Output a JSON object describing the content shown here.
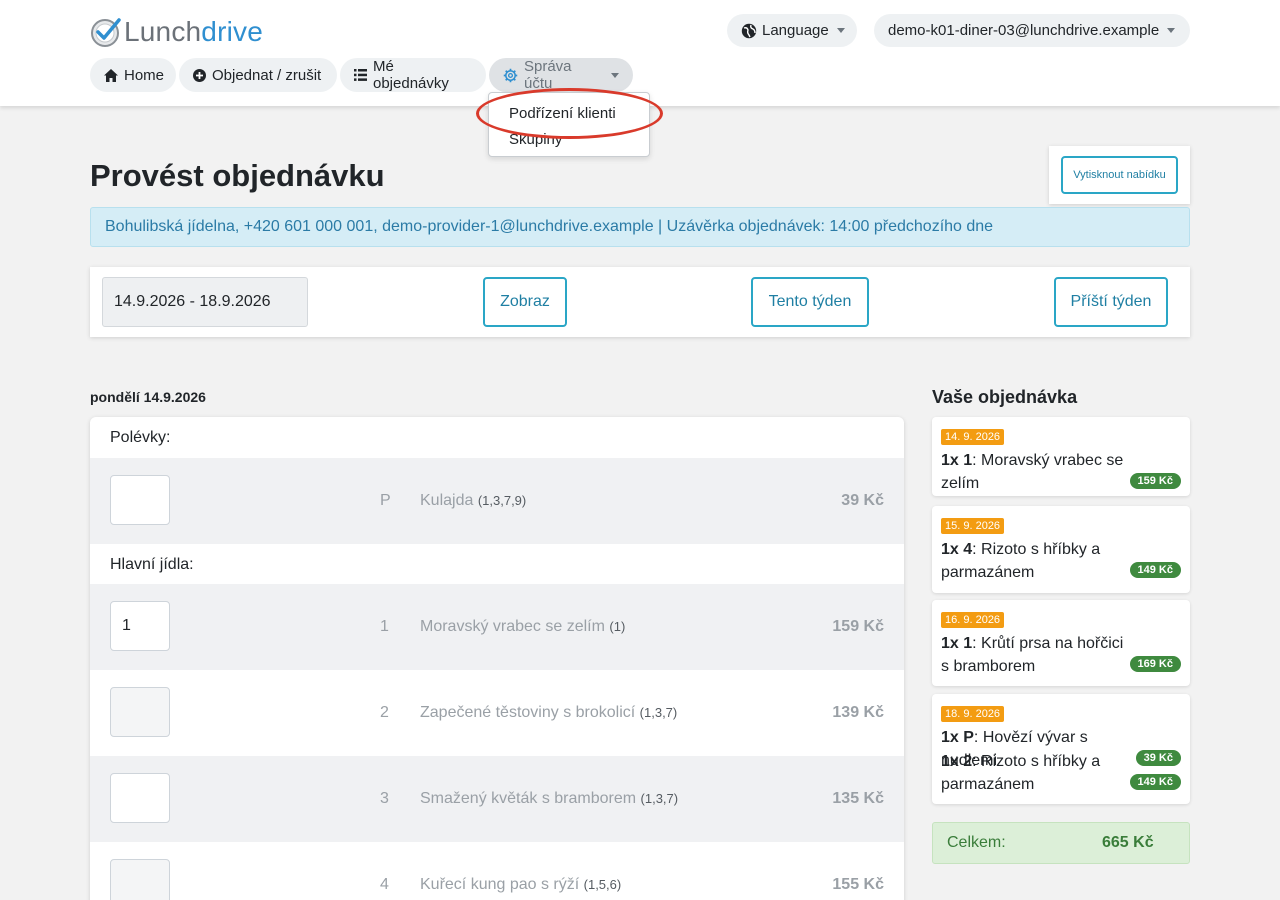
{
  "app": {
    "brand_part1": "Lunch",
    "brand_part2": "drive",
    "language_label": "Language",
    "user_email": "demo-k01-diner-03@lunchdrive.example"
  },
  "nav": {
    "home": "Home",
    "order": "Objednat / zrušit",
    "my_orders": "Mé objednávky",
    "account": "Správa účtu"
  },
  "account_menu": {
    "items": [
      "Podřízení klienti",
      "Skupiny"
    ]
  },
  "page": {
    "title": "Provést objednávku",
    "print_button": "Vytisknout nabídku",
    "info": "Bohulibská jídelna, +420 601 000 001, demo-provider-1@lunchdrive.example | Uzávěrka objednávek: 14:00 předchozího dne"
  },
  "week": {
    "range": "14.9.2026 - 18.9.2026",
    "show_button": "Zobraz",
    "this_week": "Tento týden",
    "next_week": "Příští týden"
  },
  "day": {
    "label": "pondělí 14.9.2026",
    "soups_label": "Polévky:",
    "mains_label": "Hlavní jídla:",
    "soups": [
      {
        "qty": "",
        "code": "P",
        "name": "Kulajda",
        "allergens": "(1,3,7,9)",
        "price": "39 Kč"
      }
    ],
    "mains": [
      {
        "qty": "1",
        "code": "1",
        "name": "Moravský vrabec se zelím",
        "allergens": "(1)",
        "price": "159 Kč"
      },
      {
        "qty": "",
        "code": "2",
        "name": "Zapečené těstoviny s brokolicí",
        "allergens": "(1,3,7)",
        "price": "139 Kč"
      },
      {
        "qty": "",
        "code": "3",
        "name": "Smažený květák s bramborem",
        "allergens": "(1,3,7)",
        "price": "135 Kč"
      },
      {
        "qty": "",
        "code": "4",
        "name": "Kuřecí kung pao s rýží",
        "allergens": "(1,5,6)",
        "price": "155 Kč"
      }
    ]
  },
  "summary": {
    "title": "Vaše objednávka",
    "orders": [
      {
        "date": "14. 9. 2026",
        "lines": [
          {
            "qty": "1x 1",
            "text": "Moravský vrabec se zelím",
            "price": "159 Kč"
          }
        ]
      },
      {
        "date": "15. 9. 2026",
        "lines": [
          {
            "qty": "1x 4",
            "text": "Rizoto s hříbky a parmazánem",
            "price": "149 Kč"
          }
        ]
      },
      {
        "date": "16. 9. 2026",
        "lines": [
          {
            "qty": "1x 1",
            "text": "Krůtí prsa na hořčici s bramborem",
            "price": "169 Kč"
          }
        ]
      },
      {
        "date": "18. 9. 2026",
        "lines": [
          {
            "qty": "1x P",
            "text": "Hovězí vývar s nudlemi",
            "price": "39 Kč"
          },
          {
            "qty": "1x 2",
            "text": "Rizoto s hříbky a parmazánem",
            "price": "149 Kč"
          }
        ]
      }
    ],
    "total_label": "Celkem:",
    "total_value": "665 Kč"
  },
  "colors": {
    "brand_blue": "#2f8fd0",
    "accent_teal": "#2aa6c6",
    "info_bg": "#d5edf6",
    "date_badge": "#f39c12",
    "price_badge": "#3f8a3f",
    "total_bg": "#dcefd8",
    "highlight_red": "#d93a2b"
  }
}
